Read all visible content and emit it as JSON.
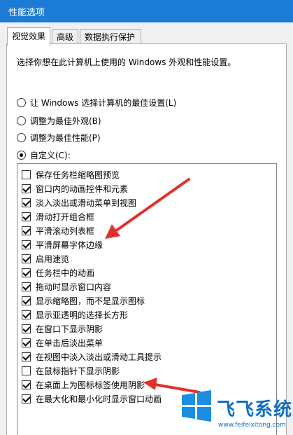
{
  "window": {
    "title": "性能选项"
  },
  "tabs": [
    {
      "label": "视觉效果"
    },
    {
      "label": "高级"
    },
    {
      "label": "数据执行保护"
    }
  ],
  "description": "选择你想在此计算机上使用的 Windows 外观和性能设置。",
  "radios": [
    {
      "label": "让 Windows 选择计算机的最佳设置(L)",
      "checked": false
    },
    {
      "label": "调整为最佳外观(B)",
      "checked": false
    },
    {
      "label": "调整为最佳性能(P)",
      "checked": false
    },
    {
      "label": "自定义(C):",
      "checked": true
    }
  ],
  "options": [
    {
      "label": "保存任务栏缩略图预览",
      "checked": false
    },
    {
      "label": "窗口内的动画控件和元素",
      "checked": true
    },
    {
      "label": "淡入淡出或滑动菜单到视图",
      "checked": true
    },
    {
      "label": "滑动打开组合框",
      "checked": true
    },
    {
      "label": "平滑滚动列表框",
      "checked": true
    },
    {
      "label": "平滑屏幕字体边缘",
      "checked": true
    },
    {
      "label": "启用速览",
      "checked": true
    },
    {
      "label": "任务栏中的动画",
      "checked": true
    },
    {
      "label": "拖动时显示窗口内容",
      "checked": true
    },
    {
      "label": "显示缩略图，而不是显示图标",
      "checked": true
    },
    {
      "label": "显示亚透明的选择长方形",
      "checked": true
    },
    {
      "label": "在窗口下显示阴影",
      "checked": true
    },
    {
      "label": "在单击后淡出菜单",
      "checked": true
    },
    {
      "label": "在视图中淡入淡出或滑动工具提示",
      "checked": true
    },
    {
      "label": "在鼠标指针下显示阴影",
      "checked": false
    },
    {
      "label": "在桌面上为图标标签使用阴影",
      "checked": true
    },
    {
      "label": "在最大化和最小化时显示窗口动画",
      "checked": true
    }
  ],
  "watermark": {
    "text": "飞飞系统",
    "url": "www.feifeixitong.com"
  },
  "colors": {
    "titlebar": "#1c7cd5",
    "arrow": "#e0322a",
    "brand": "#0e6fc7"
  }
}
